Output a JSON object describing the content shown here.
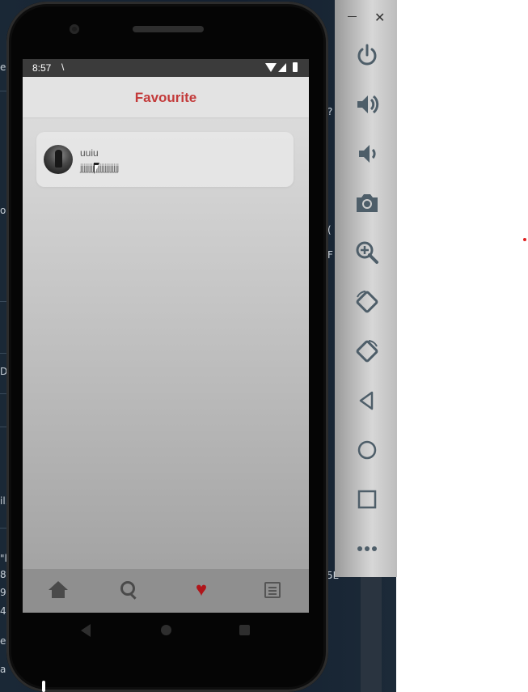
{
  "status_bar": {
    "time": "8:57",
    "extra_glyph": "\\"
  },
  "app": {
    "title": "Favourite",
    "favourites": [
      {
        "title": "uuiu",
        "subtitle": "jjjjjjjjjjjjjjjjjjjjjj"
      }
    ]
  },
  "bottom_nav": [
    {
      "icon": "home-icon"
    },
    {
      "icon": "search-icon"
    },
    {
      "icon": "heart-icon",
      "active": true,
      "color": "#b0151a"
    },
    {
      "icon": "list-icon"
    }
  ],
  "emulator_panel": {
    "window_controls": {
      "minimize": "–",
      "close": "✕"
    },
    "tools": [
      "power-icon",
      "volume-up-icon",
      "volume-down-icon",
      "camera-icon",
      "zoom-in-icon",
      "rotate-left-icon",
      "rotate-right-icon",
      "back-icon",
      "home-icon",
      "overview-icon",
      "more-icon"
    ]
  },
  "background_fragments": {
    "left_edge_text": [
      "e",
      "o",
      "D",
      "il.",
      "\"l",
      "8",
      "9",
      "4",
      "e",
      "a"
    ],
    "right_fragments": [
      "?",
      "(",
      "F",
      "5"
    ],
    "bottom_right_number": "5E"
  },
  "colors": {
    "accent": "#c33a3a",
    "heart": "#b0151a",
    "panel_icons": "#4e5e69"
  }
}
